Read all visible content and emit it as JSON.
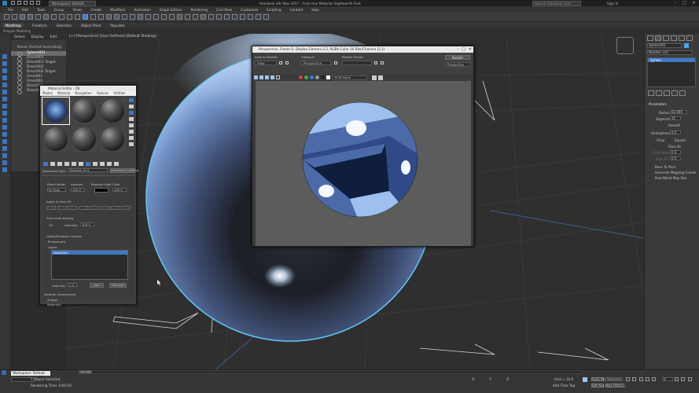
{
  "titlebar": {
    "workspace": "Workspace: Default",
    "title": "Autodesk 3ds Max 2017 - Fruit.max    Material: Eighteenth.Fruit",
    "search_placeholder": "Search Autodesk.com",
    "sign_in": "Sign In",
    "min": "–",
    "max": "□",
    "close": "✕"
  },
  "menus": [
    "File",
    "Edit",
    "Tools",
    "Group",
    "Views",
    "Create",
    "Modifiers",
    "Animation",
    "Graph Editors",
    "Rendering",
    "Civil View",
    "Customize",
    "Scripting",
    "Content",
    "Help"
  ],
  "ribbon": {
    "tabs": [
      "Modeling",
      "Freeform",
      "Selection",
      "Object Paint",
      "Populate"
    ],
    "active_tab": "Modeling",
    "subrow": "Polygon Modeling"
  },
  "explorer": {
    "tabs": [
      "Select",
      "Display",
      "Edit"
    ],
    "header": "Name (Sorted Ascending)",
    "items": [
      "Sphere001",
      "Direct001",
      "Direct001.Target",
      "Direct002",
      "Direct002.Target",
      "Omni001",
      "Omni002",
      "Direct003",
      "Direct003.Target"
    ],
    "selected_index": 0
  },
  "viewport": {
    "label": "[+] [Perspective] [User Defined] [Default Shading]"
  },
  "material_editor": {
    "title": "Material Editor - 08",
    "menus": [
      "Modes",
      "Material",
      "Navigation",
      "Options",
      "Utilities"
    ],
    "name_label": "Advanced Light",
    "mat_name": "Material #31",
    "type_button": "Advanced Lighting",
    "blend_mode_label": "Blend Mode:",
    "blend_value": "By Row",
    "amount_label": "Amount:",
    "amount_value": "100.0",
    "replace_color_label": "Replace Light Color",
    "replace_color_value": "100.0",
    "apply_label": "Apply to Face ID:",
    "zone_label": "Zone Anti-aliasing",
    "zone_on": "On",
    "intensity_label": "Intensity:",
    "intensity_value": "100.0",
    "light_label": "Lights/Shadow Controls",
    "photo_label": "Photometric",
    "lights_label": "Lights",
    "list_item": "Direct001",
    "list_intensity": "Intensity:",
    "list_intensity_value": "1.0",
    "add_btn": "Add",
    "remove_btn": "Remove",
    "mat_comp_label": "Material Components",
    "shader_label": "Shader",
    "materials_label": "Materials"
  },
  "render_frame": {
    "title": "Perspective, Frame 0, Display Gamma 2.2, RGBA Color 16 Bits/Channel (1:1)",
    "area_label": "Area to Render:",
    "area_value": "View",
    "viewport_label": "Viewport:",
    "viewport_value": "Perspective",
    "preset_label": "Render Preset:",
    "preset_value": "",
    "render_btn": "Render",
    "production_value": "Production",
    "channel_value": "RGB Alpha"
  },
  "command_panel": {
    "object_name": "Sphere001",
    "modifier_list": "Modifier List",
    "stack_item": "Sphere",
    "parameters": "Parameters",
    "radius_label": "Radius:",
    "radius_value": "62.000",
    "segments_label": "Segments:",
    "segments_value": "32",
    "smooth": "Smooth",
    "hemisphere_label": "Hemisphere:",
    "hemisphere_value": "0.0",
    "chop": "Chop",
    "squash": "Squash",
    "slice_on": "Slice On",
    "slice_from_label": "Slice From:",
    "slice_from_value": "0.0",
    "slice_to_label": "Slice To:",
    "slice_to_value": "0.0",
    "base_to_pivot": "Base To Pivot",
    "gen_mapping": "Generate Mapping Coords.",
    "real_world": "Real-World Map Size"
  },
  "status": {
    "time_slider": "0 / 100",
    "workspace_bottom": "Workspace: Default",
    "objects_selected": "1 Object Selected",
    "rendering_time": "Rendering Time: 0:00:10",
    "x_label": "X:",
    "y_label": "Y:",
    "z_label": "Z:",
    "grid": "Grid = 10.0",
    "autokey": "Auto Key",
    "selected": "Selected",
    "setkey": "Set Key",
    "keyfilters": "Key Filters...",
    "frame": "0",
    "add_time_tag": "Add Time Tag"
  },
  "colors": {
    "accent": "#3f78c4",
    "sphere_outline": "#5fc2f2"
  }
}
